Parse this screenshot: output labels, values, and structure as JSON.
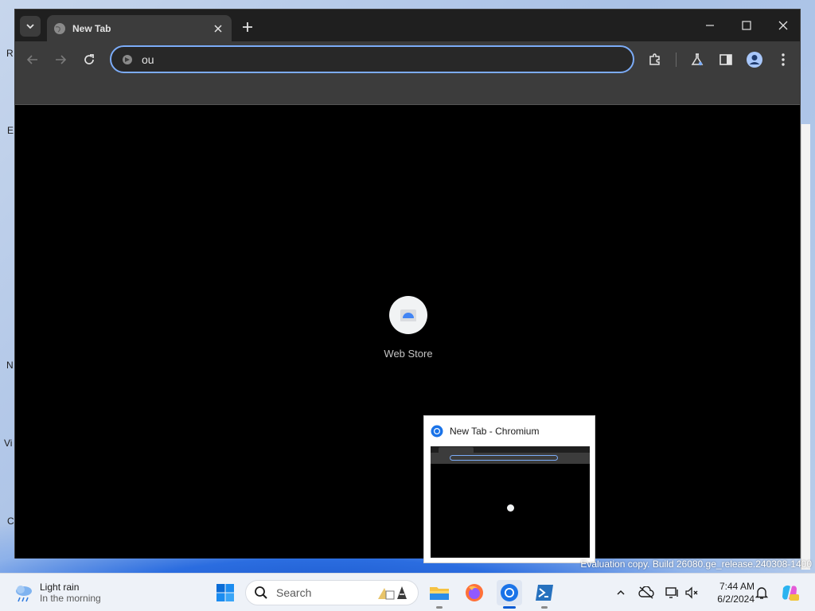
{
  "browser": {
    "tab": {
      "title": "New Tab"
    },
    "omnibox": {
      "value": "ou"
    },
    "shortcuts": [
      {
        "label": "Web Store"
      }
    ]
  },
  "desktop": {
    "watermark": "Evaluation copy. Build 26080.ge_release.240308-1400",
    "edge_labels": [
      "R",
      "E",
      "N",
      "Vi",
      "C"
    ]
  },
  "preview": {
    "title": "New Tab - Chromium"
  },
  "taskbar": {
    "weather": {
      "condition": "Light rain",
      "detail": "In the morning"
    },
    "search_placeholder": "Search",
    "clock": {
      "time": "7:44 AM",
      "date": "6/2/2024"
    }
  },
  "colors": {
    "omnibox_focus": "#7cacf8",
    "chrome_dark": "#3c3c3c",
    "taskbar_accent": "#0a5bd3"
  }
}
